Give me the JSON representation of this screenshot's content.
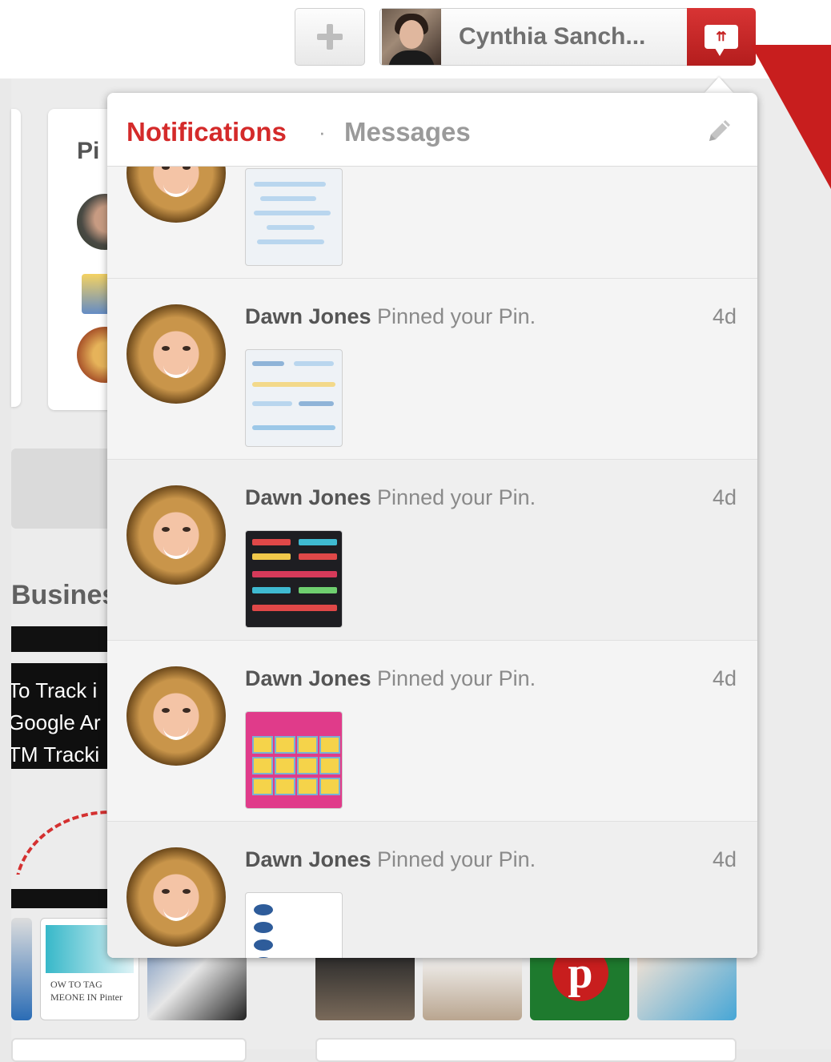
{
  "header": {
    "add_icon": "plus-icon",
    "profile_name": "Cynthia Sanch...",
    "notifications_icon": "pin-bubble-icon",
    "notifications_glyph": "⇈"
  },
  "background": {
    "card_heading_partial": "Pi",
    "section_heading_partial": "Busines",
    "pin_text_lines": [
      "To Track i",
      "Google Ar",
      "TM Tracki"
    ],
    "thumb_caption": [
      "OW TO TAG",
      "MEONE IN Pinter"
    ],
    "pin_logo_letter": "p"
  },
  "dropdown": {
    "tabs": {
      "notifications": "Notifications",
      "separator": "·",
      "messages": "Messages"
    },
    "compose_icon": "pencil-icon",
    "items": [
      {
        "name": "",
        "action": "",
        "time": "",
        "thumb": "light"
      },
      {
        "name": "Dawn Jones",
        "action": " Pinned your Pin.",
        "time": "4d",
        "thumb": "light"
      },
      {
        "name": "Dawn Jones",
        "action": " Pinned your Pin.",
        "time": "4d",
        "thumb": "dark"
      },
      {
        "name": "Dawn Jones",
        "action": " Pinned your Pin.",
        "time": "4d",
        "thumb": "pink"
      },
      {
        "name": "Dawn Jones",
        "action": " Pinned your Pin.",
        "time": "4d",
        "thumb": "blue"
      }
    ]
  },
  "colors": {
    "accent_red": "#d42a2a",
    "muted_text": "#9a9a9a"
  }
}
